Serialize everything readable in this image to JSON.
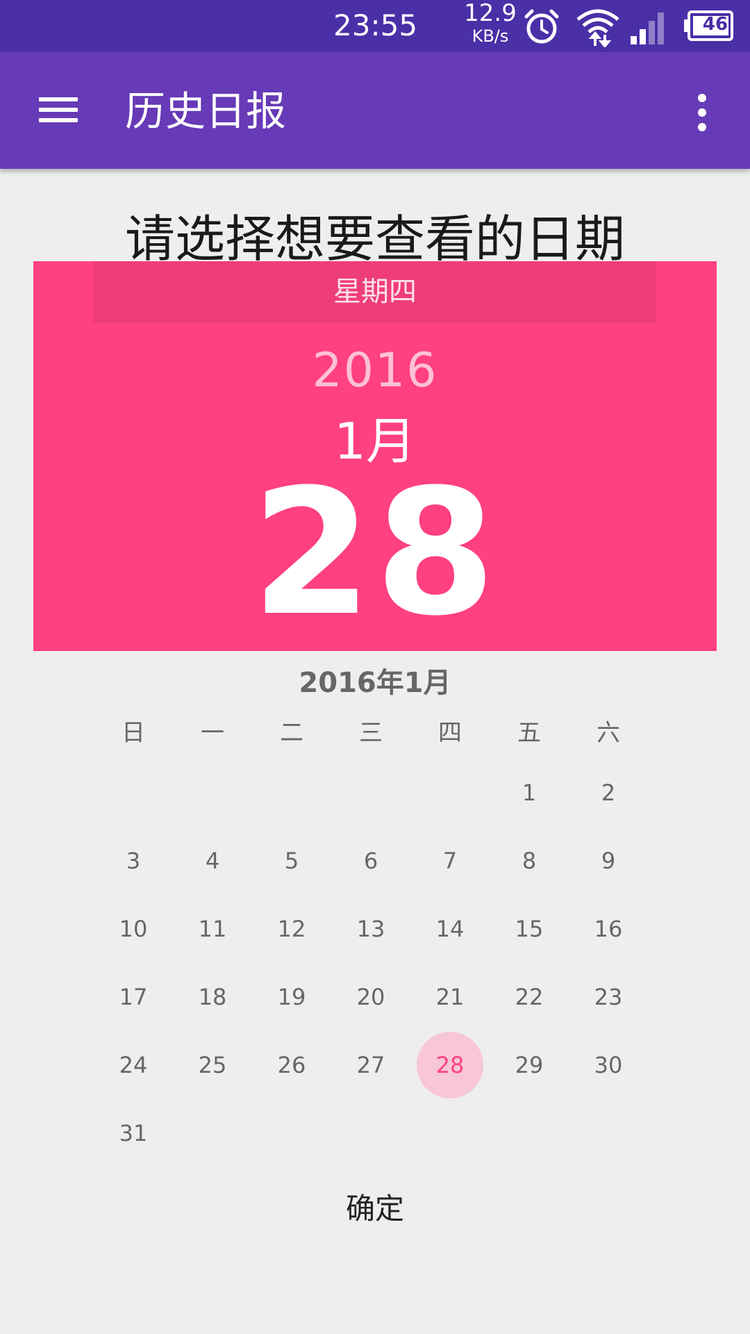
{
  "status_bar": {
    "time": "23:55",
    "net_speed_value": "12.9",
    "net_speed_unit": "KB/s",
    "battery": "46",
    "icons": [
      "alarm-icon",
      "wifi-icon",
      "signal-icon",
      "battery-icon"
    ]
  },
  "app_bar": {
    "title": "历史日报",
    "menu_icon": "hamburger-menu-icon",
    "overflow_icon": "more-vert-icon"
  },
  "prompt": "请选择想要查看的日期",
  "date_header": {
    "weekday": "星期四",
    "year": "2016",
    "month": "1月",
    "day": "28"
  },
  "calendar": {
    "title": "2016年1月",
    "weekdays": [
      "日",
      "一",
      "二",
      "三",
      "四",
      "五",
      "六"
    ],
    "weeks": [
      [
        "",
        "",
        "",
        "",
        "",
        "1",
        "2"
      ],
      [
        "3",
        "4",
        "5",
        "6",
        "7",
        "8",
        "9"
      ],
      [
        "10",
        "11",
        "12",
        "13",
        "14",
        "15",
        "16"
      ],
      [
        "17",
        "18",
        "19",
        "20",
        "21",
        "22",
        "23"
      ],
      [
        "24",
        "25",
        "26",
        "27",
        "28",
        "29",
        "30"
      ],
      [
        "31",
        "",
        "",
        "",
        "",
        "",
        ""
      ]
    ],
    "selected_day": "28"
  },
  "ok_label": "确定",
  "colors": {
    "status_bar": "#4a2fa6",
    "app_bar": "#673ab7",
    "accent": "#ff4081",
    "weekday_bar": "#ef3d78",
    "selected_circle": "#f7c6d8",
    "background": "#eeeeee"
  }
}
